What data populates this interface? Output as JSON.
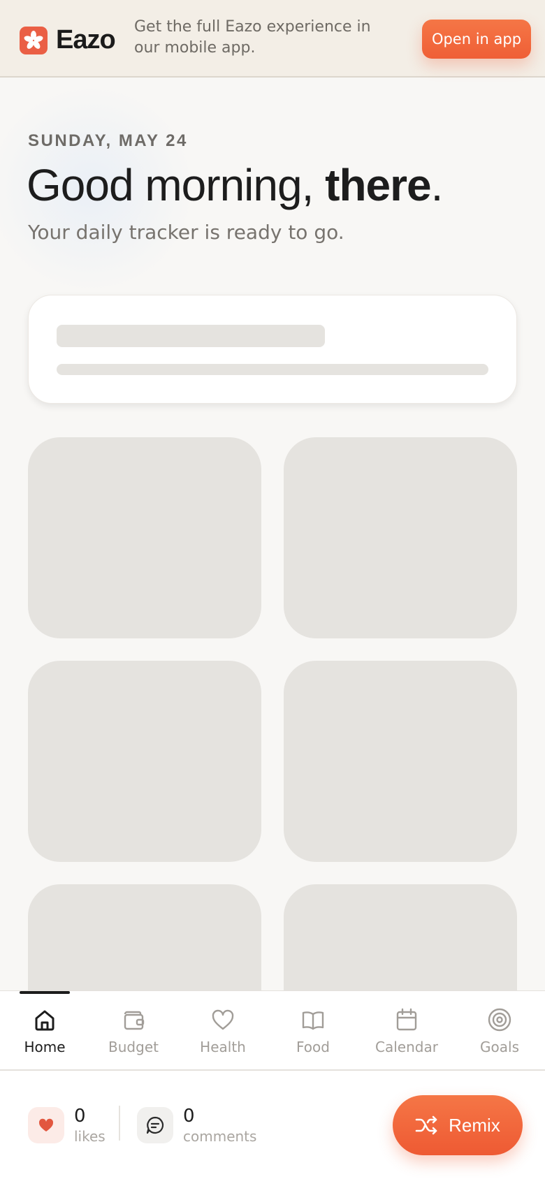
{
  "banner": {
    "brand": "Eazo",
    "message": "Get the full Eazo experience in our mobile app.",
    "open_button": "Open in app"
  },
  "hero": {
    "date": "SUNDAY, MAY 24",
    "greeting_prefix": "Good morning, ",
    "greeting_name": "there",
    "greeting_suffix": ".",
    "subtitle": "Your daily tracker is ready to go."
  },
  "tabs": [
    {
      "label": "Home",
      "icon": "home-icon",
      "active": true
    },
    {
      "label": "Budget",
      "icon": "wallet-icon",
      "active": false
    },
    {
      "label": "Health",
      "icon": "heart-icon",
      "active": false
    },
    {
      "label": "Food",
      "icon": "book-icon",
      "active": false
    },
    {
      "label": "Calendar",
      "icon": "calendar-icon",
      "active": false
    },
    {
      "label": "Goals",
      "icon": "target-icon",
      "active": false
    }
  ],
  "footer": {
    "likes_count": "0",
    "likes_label": "likes",
    "comments_count": "0",
    "comments_label": "comments",
    "remix_label": "Remix"
  },
  "colors": {
    "accent": "#ef5f36",
    "brand_mark": "#ea5f45",
    "skeleton": "#e5e3df",
    "banner_bg": "#f3eee6"
  }
}
